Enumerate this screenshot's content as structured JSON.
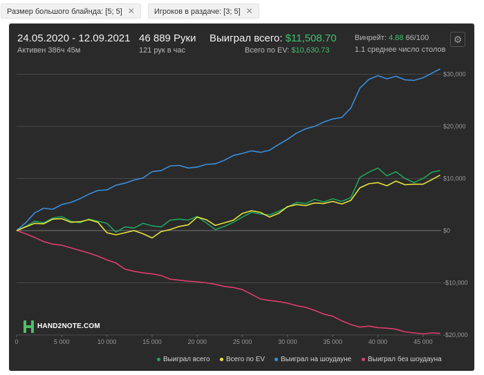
{
  "filters": {
    "big_blind": "Размер большого блайнда: [5; 5]",
    "players": "Игроков в раздаче: [3; 5]",
    "remove_glyph": "✕"
  },
  "stats": {
    "date_range": "24.05.2020 - 12.09.2021",
    "active": "Активен 386ч 45м",
    "hands": "46 889 Руки",
    "hands_per_hour": "121 рук в час",
    "won_total_label": "Выиграл всего:",
    "won_total_value": "$11,508.70",
    "ev_total_label": "Всего по EV:",
    "ev_total_value": "$10,630.73",
    "winrate_label": "Винрейт:",
    "winrate_value": "4.88",
    "winrate_suffix": "66/100",
    "avg_tables": "1.1 среднее число столов"
  },
  "logo_text": "HAND2NOTE.COM",
  "colors": {
    "won_total": "#1fa560",
    "ev": "#e8e53a",
    "showdown": "#3a8fe0",
    "non_showdown": "#e03d6c"
  },
  "chart_data": {
    "type": "line",
    "title": "",
    "xlabel": "",
    "ylabel": "",
    "xlim": [
      0,
      47000
    ],
    "ylim": [
      -20000,
      31500
    ],
    "x_ticks": [
      0,
      5000,
      10000,
      15000,
      20000,
      25000,
      30000,
      35000,
      40000,
      45000
    ],
    "x_tick_labels": [
      "0",
      "5 000",
      "10 000",
      "15 000",
      "20 000",
      "25 000",
      "30 000",
      "35 000",
      "40 000",
      "45 000"
    ],
    "y_ticks": [
      30000,
      20000,
      10000,
      0,
      -10000,
      -20000
    ],
    "y_tick_labels": [
      "$30,000",
      "$20,000",
      "$10,000",
      "$0",
      "-$10,000",
      "-$20,000"
    ],
    "grid": true,
    "legend_position": "bottom-right",
    "series": [
      {
        "name": "Выиграл всего",
        "x": [
          0,
          1000,
          2000,
          3000,
          4000,
          5000,
          6000,
          7000,
          8000,
          9000,
          10000,
          11000,
          12000,
          13000,
          14000,
          15000,
          16000,
          17000,
          18000,
          19000,
          20000,
          21000,
          22000,
          23000,
          24000,
          25000,
          26000,
          27000,
          28000,
          29000,
          30000,
          31000,
          32000,
          33000,
          34000,
          35000,
          36000,
          37000,
          38000,
          39000,
          40000,
          41000,
          42000,
          43000,
          44000,
          45000,
          46000,
          46889
        ],
        "values": [
          0,
          800,
          1800,
          1500,
          2400,
          2700,
          1800,
          1500,
          2200,
          1800,
          1400,
          -300,
          700,
          500,
          1400,
          900,
          700,
          2000,
          2200,
          2000,
          2700,
          1500,
          200,
          800,
          1600,
          2600,
          3500,
          3200,
          3000,
          3700,
          4500,
          5400,
          5200,
          6000,
          5500,
          6100,
          5600,
          6300,
          10200,
          11200,
          12000,
          10500,
          11300,
          10000,
          9200,
          10000,
          11200,
          11508
        ]
      },
      {
        "name": "Всего по EV",
        "x": [
          0,
          1000,
          2000,
          3000,
          4000,
          5000,
          6000,
          7000,
          8000,
          9000,
          10000,
          11000,
          12000,
          13000,
          14000,
          15000,
          16000,
          17000,
          18000,
          19000,
          20000,
          21000,
          22000,
          23000,
          24000,
          25000,
          26000,
          27000,
          28000,
          29000,
          30000,
          31000,
          32000,
          33000,
          34000,
          35000,
          36000,
          37000,
          38000,
          39000,
          40000,
          41000,
          42000,
          43000,
          44000,
          45000,
          46000,
          46889
        ],
        "values": [
          0,
          700,
          1400,
          1300,
          2200,
          2300,
          1600,
          1700,
          2100,
          1600,
          -400,
          -800,
          -400,
          0,
          -600,
          -1400,
          -200,
          200,
          800,
          1100,
          2600,
          2100,
          1000,
          1500,
          2000,
          3300,
          3800,
          3500,
          2600,
          3300,
          4600,
          5000,
          4800,
          5300,
          5200,
          5600,
          5100,
          5800,
          8200,
          9000,
          9200,
          8600,
          9500,
          8800,
          8900,
          8900,
          9800,
          10630
        ]
      },
      {
        "name": "Выиграл на шоудауне",
        "x": [
          0,
          1000,
          2000,
          3000,
          4000,
          5000,
          6000,
          7000,
          8000,
          9000,
          10000,
          11000,
          12000,
          13000,
          14000,
          15000,
          16000,
          17000,
          18000,
          19000,
          20000,
          21000,
          22000,
          23000,
          24000,
          25000,
          26000,
          27000,
          28000,
          29000,
          30000,
          31000,
          32000,
          33000,
          34000,
          35000,
          36000,
          37000,
          38000,
          39000,
          40000,
          41000,
          42000,
          43000,
          44000,
          45000,
          46000,
          46889
        ],
        "values": [
          0,
          1500,
          3400,
          4300,
          4100,
          5000,
          5400,
          6100,
          7000,
          7700,
          7800,
          8700,
          9100,
          9700,
          10100,
          11300,
          11500,
          12400,
          12500,
          12000,
          12200,
          12700,
          12800,
          13500,
          14400,
          14800,
          15300,
          15000,
          15400,
          16500,
          17500,
          18700,
          19500,
          20000,
          20800,
          21400,
          21700,
          23500,
          27300,
          29000,
          29700,
          29100,
          29600,
          28900,
          28800,
          29300,
          30200,
          31000
        ]
      },
      {
        "name": "Выиграл без шоудауна",
        "x": [
          0,
          1000,
          2000,
          3000,
          4000,
          5000,
          6000,
          7000,
          8000,
          9000,
          10000,
          11000,
          12000,
          13000,
          14000,
          15000,
          16000,
          17000,
          18000,
          19000,
          20000,
          21000,
          22000,
          23000,
          24000,
          25000,
          26000,
          27000,
          28000,
          29000,
          30000,
          31000,
          32000,
          33000,
          34000,
          35000,
          36000,
          37000,
          38000,
          39000,
          40000,
          41000,
          42000,
          43000,
          44000,
          45000,
          46000,
          46889
        ],
        "values": [
          0,
          -600,
          -1300,
          -2100,
          -2600,
          -2800,
          -3300,
          -3800,
          -4300,
          -4900,
          -5600,
          -6200,
          -7400,
          -7800,
          -8100,
          -8300,
          -8600,
          -9300,
          -9500,
          -9700,
          -9800,
          -10000,
          -10300,
          -10700,
          -10900,
          -11300,
          -12200,
          -13100,
          -13400,
          -13600,
          -13900,
          -14400,
          -14700,
          -15300,
          -16000,
          -16400,
          -17300,
          -18000,
          -18500,
          -18300,
          -18600,
          -18700,
          -18900,
          -19400,
          -19600,
          -19800,
          -19600,
          -19700
        ]
      }
    ]
  }
}
